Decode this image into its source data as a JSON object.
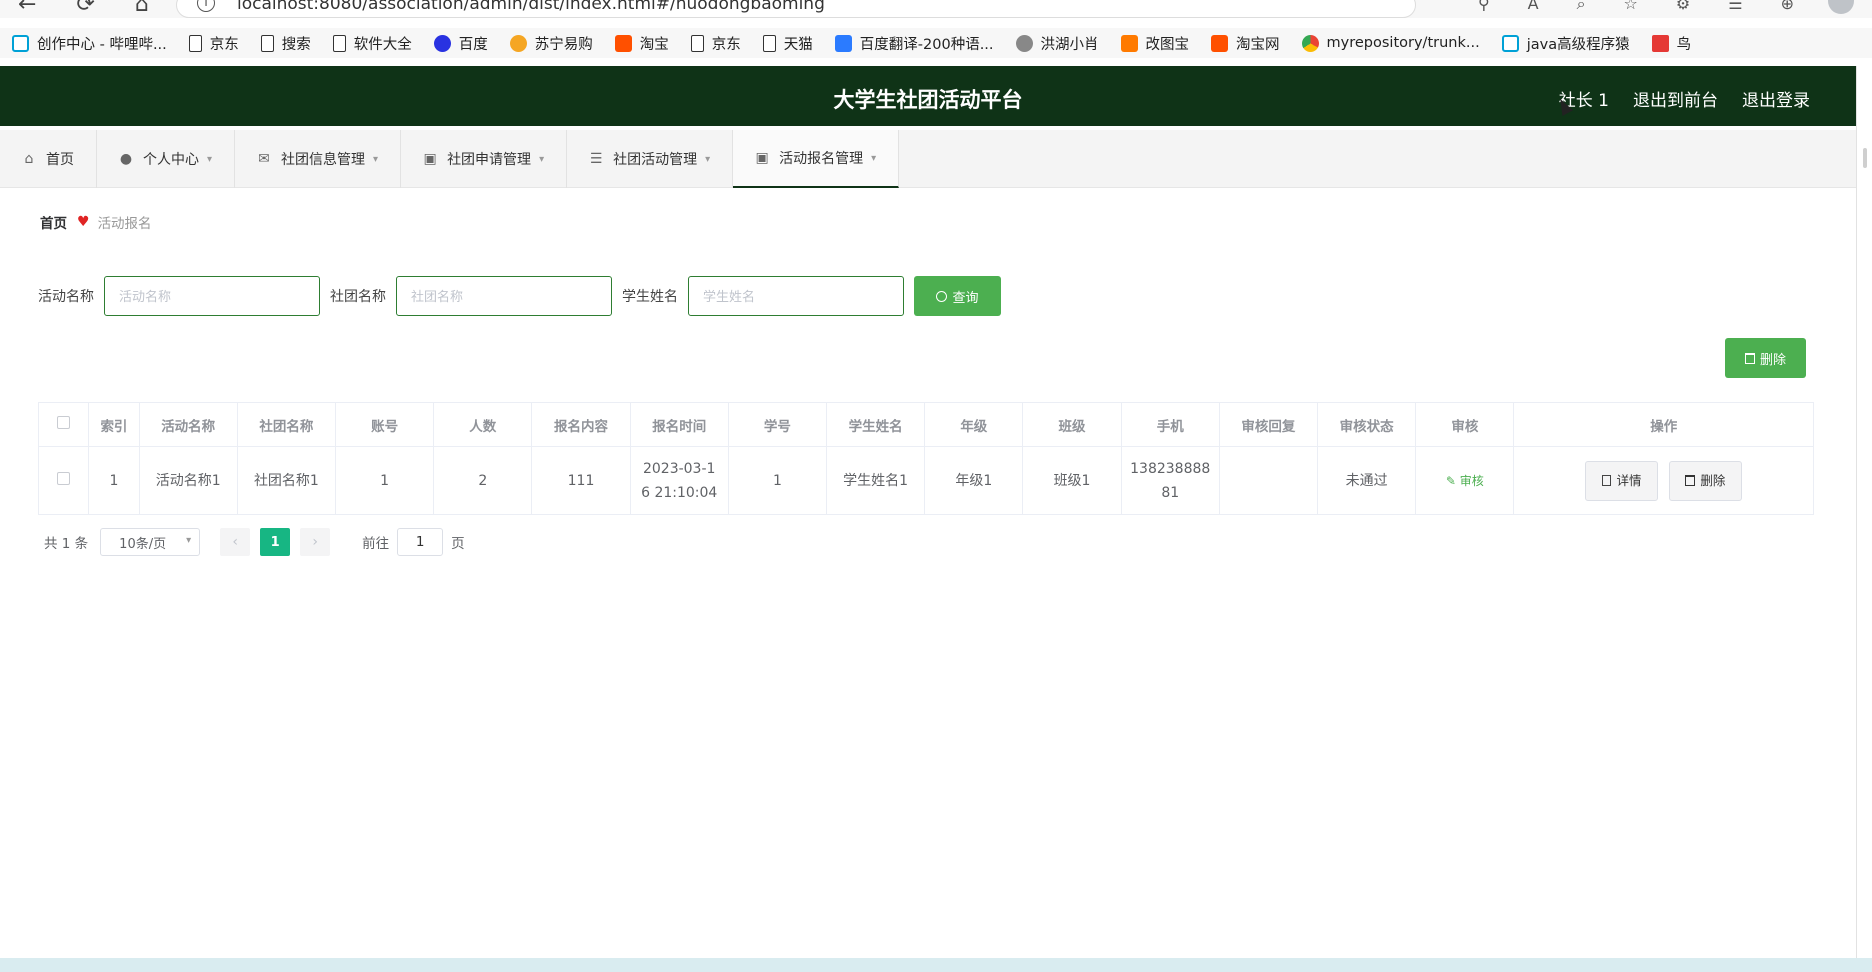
{
  "browser": {
    "url": "localhost:8080/association/admin/dist/index.html#/huodongbaoming",
    "bookmarks": [
      {
        "label": "创作中心 - 哔哩哔...",
        "icon": "bilibili-icon"
      },
      {
        "label": "京东",
        "icon": "page-icon"
      },
      {
        "label": "搜索",
        "icon": "page-icon"
      },
      {
        "label": "软件大全",
        "icon": "page-icon"
      },
      {
        "label": "百度",
        "icon": "baidu-icon"
      },
      {
        "label": "苏宁易购",
        "icon": "suning-icon"
      },
      {
        "label": "淘宝",
        "icon": "taobao-icon"
      },
      {
        "label": "京东",
        "icon": "page-icon"
      },
      {
        "label": "天猫",
        "icon": "page-icon"
      },
      {
        "label": "百度翻译-200种语...",
        "icon": "fanyi-icon"
      },
      {
        "label": "洪湖小肖",
        "icon": "hh-icon"
      },
      {
        "label": "改图宝",
        "icon": "gaitubao-icon"
      },
      {
        "label": "淘宝网",
        "icon": "taobao-icon"
      },
      {
        "label": "myrepository/trunk...",
        "icon": "chrome-icon"
      },
      {
        "label": "java高级程序猿",
        "icon": "bilibili-icon"
      },
      {
        "label": "鸟",
        "icon": "niao-icon"
      }
    ]
  },
  "header": {
    "title": "大学生社团活动平台",
    "user": "社长 1",
    "front_link": "退出到前台",
    "logout_link": "退出登录"
  },
  "menu": {
    "items": [
      {
        "label": "首页",
        "icon": "home-icon"
      },
      {
        "label": "个人中心",
        "icon": "user-icon"
      },
      {
        "label": "社团信息管理",
        "icon": "mail-icon"
      },
      {
        "label": "社团申请管理",
        "icon": "clipboard-icon"
      },
      {
        "label": "社团活动管理",
        "icon": "list-icon"
      },
      {
        "label": "活动报名管理",
        "icon": "clipboard-icon"
      }
    ]
  },
  "breadcrumb": {
    "home": "首页",
    "current": "活动报名"
  },
  "search": {
    "activity_label": "活动名称",
    "activity_placeholder": "活动名称",
    "club_label": "社团名称",
    "club_placeholder": "社团名称",
    "student_label": "学生姓名",
    "student_placeholder": "学生姓名",
    "button": "查询"
  },
  "toolbar": {
    "delete_label": "删除"
  },
  "table": {
    "headers": [
      "索引",
      "活动名称",
      "社团名称",
      "账号",
      "人数",
      "报名内容",
      "报名时间",
      "学号",
      "学生姓名",
      "年级",
      "班级",
      "手机",
      "审核回复",
      "审核状态",
      "审核",
      "操作"
    ],
    "rows": [
      {
        "index": "1",
        "activity": "活动名称1",
        "club": "社团名称1",
        "account": "1",
        "count": "2",
        "content": "111",
        "time": "2023-03-16 21:10:04",
        "student_no": "1",
        "student": "学生姓名1",
        "grade": "年级1",
        "class": "班级1",
        "phone": "13823888881",
        "reply": "",
        "status": "未通过",
        "audit": "审核",
        "detail_btn": "详情",
        "delete_btn": "删除"
      }
    ]
  },
  "pager": {
    "total": "共 1 条",
    "page_size": "10条/页",
    "current": "1",
    "goto_prefix": "前往",
    "goto_value": "1",
    "goto_suffix": "页"
  },
  "colors": {
    "header_bg": "#0f3317",
    "accent": "#4caf50",
    "page_active": "#17b683"
  }
}
